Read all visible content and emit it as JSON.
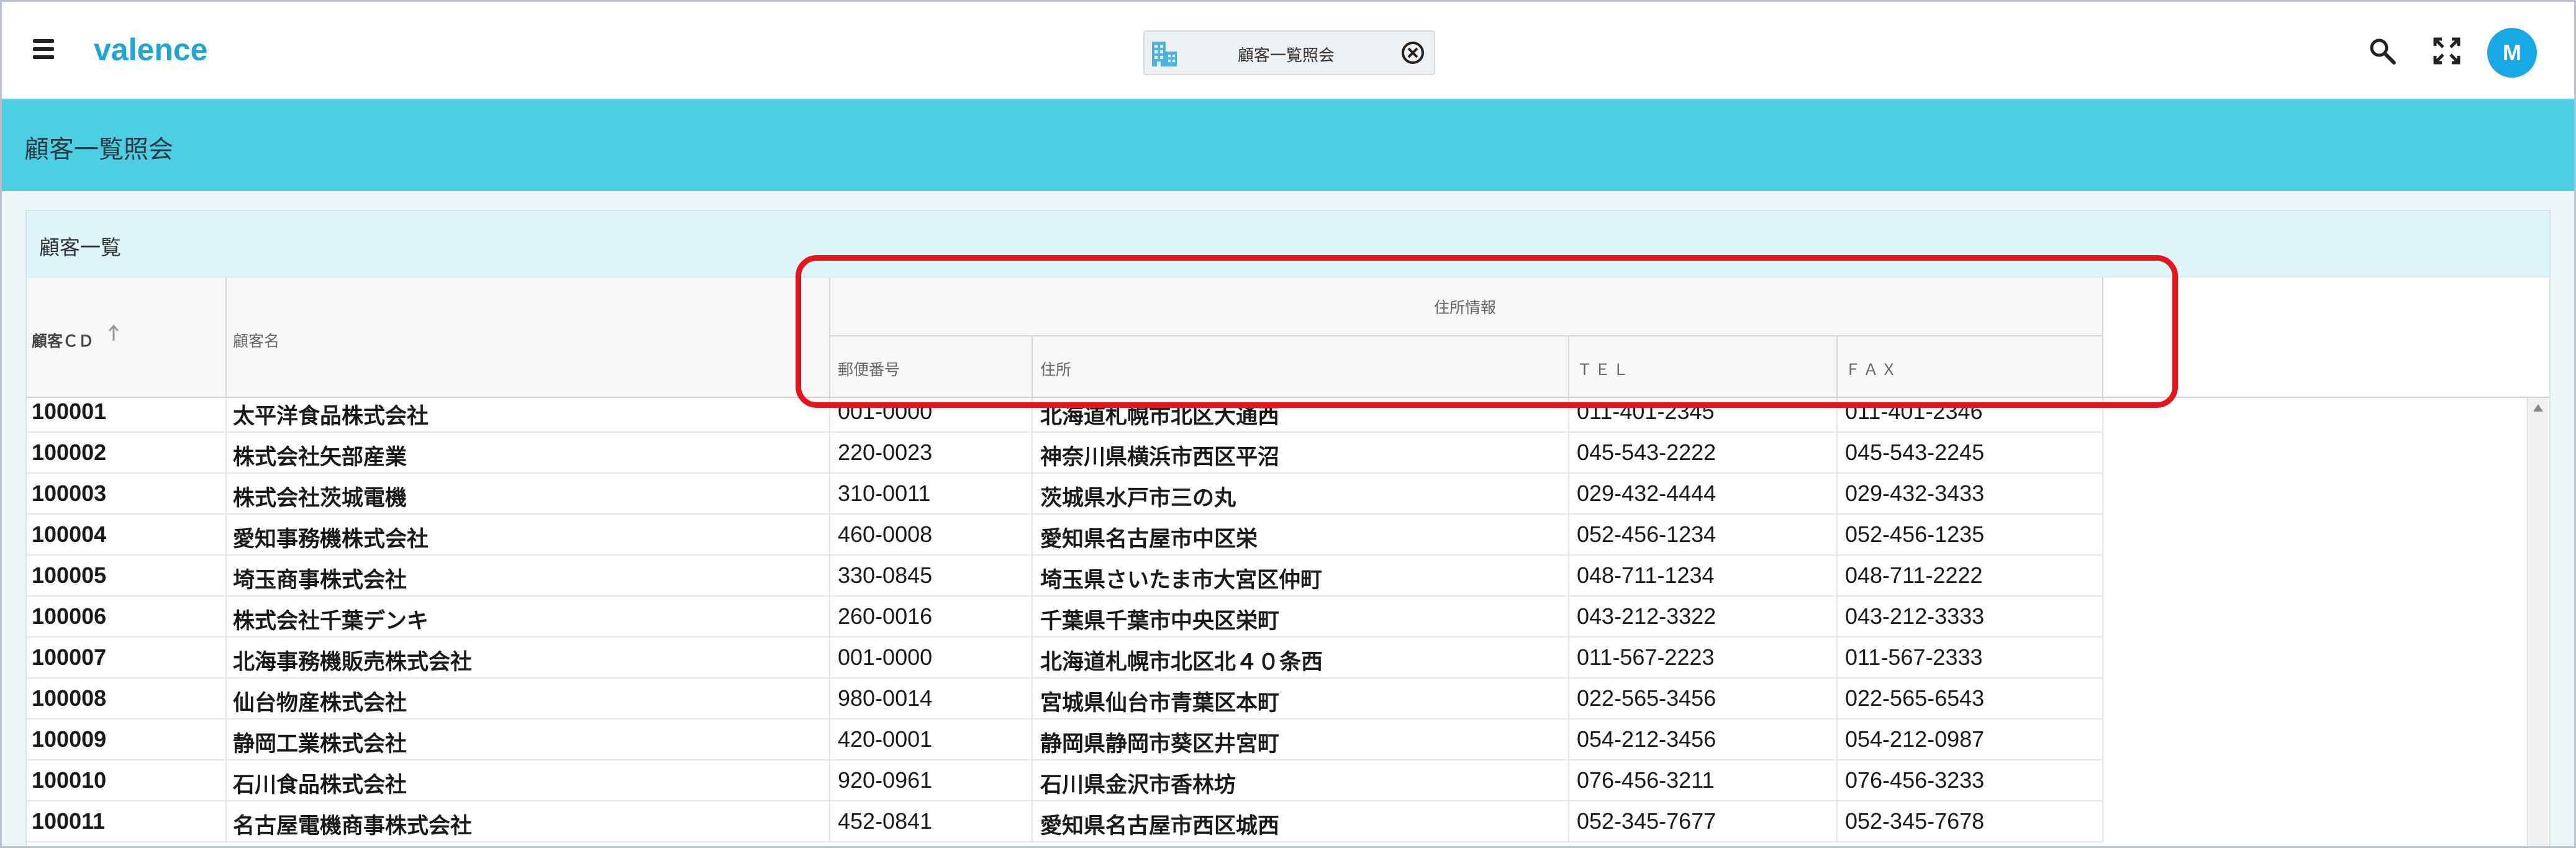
{
  "app": {
    "logo": "valence",
    "avatar_initial": "M"
  },
  "tab": {
    "label": "顧客一覧照会"
  },
  "page": {
    "title": "顧客一覧照会"
  },
  "panel": {
    "title": "顧客一覧"
  },
  "table": {
    "headers": {
      "code": "顧客ＣＤ",
      "name": "顧客名",
      "group": "住所情報",
      "zip": "郵便番号",
      "address": "住所",
      "tel": "ＴＥＬ",
      "fax": "ＦＡＸ"
    },
    "rows": [
      {
        "code": "100001",
        "name": "太平洋食品株式会社",
        "zip": "001-0000",
        "address": "北海道札幌市北区大通西",
        "tel": "011-401-2345",
        "fax": "011-401-2346"
      },
      {
        "code": "100002",
        "name": "株式会社矢部産業",
        "zip": "220-0023",
        "address": "神奈川県横浜市西区平沼",
        "tel": "045-543-2222",
        "fax": "045-543-2245"
      },
      {
        "code": "100003",
        "name": "株式会社茨城電機",
        "zip": "310-0011",
        "address": "茨城県水戸市三の丸",
        "tel": "029-432-4444",
        "fax": "029-432-3433"
      },
      {
        "code": "100004",
        "name": "愛知事務機株式会社",
        "zip": "460-0008",
        "address": "愛知県名古屋市中区栄",
        "tel": "052-456-1234",
        "fax": "052-456-1235"
      },
      {
        "code": "100005",
        "name": "埼玉商事株式会社",
        "zip": "330-0845",
        "address": "埼玉県さいたま市大宮区仲町",
        "tel": "048-711-1234",
        "fax": "048-711-2222"
      },
      {
        "code": "100006",
        "name": "株式会社千葉デンキ",
        "zip": "260-0016",
        "address": "千葉県千葉市中央区栄町",
        "tel": "043-212-3322",
        "fax": "043-212-3333"
      },
      {
        "code": "100007",
        "name": "北海事務機販売株式会社",
        "zip": "001-0000",
        "address": "北海道札幌市北区北４０条西",
        "tel": "011-567-2223",
        "fax": "011-567-2333"
      },
      {
        "code": "100008",
        "name": "仙台物産株式会社",
        "zip": "980-0014",
        "address": "宮城県仙台市青葉区本町",
        "tel": "022-565-3456",
        "fax": "022-565-6543"
      },
      {
        "code": "100009",
        "name": "静岡工業株式会社",
        "zip": "420-0001",
        "address": "静岡県静岡市葵区井宮町",
        "tel": "054-212-3456",
        "fax": "054-212-0987"
      },
      {
        "code": "100010",
        "name": "石川食品株式会社",
        "zip": "920-0961",
        "address": "石川県金沢市香林坊",
        "tel": "076-456-3211",
        "fax": "076-456-3233"
      },
      {
        "code": "100011",
        "name": "名古屋電機商事株式会社",
        "zip": "452-0841",
        "address": "愛知県名古屋市西区城西",
        "tel": "052-345-7677",
        "fax": "052-345-7678"
      }
    ]
  },
  "colors": {
    "accent": "#4ccfe3",
    "logo": "#1fa5d2",
    "avatar": "#17a9e6",
    "highlight": "#e8141c"
  },
  "icons": {
    "menu": "hamburger-icon",
    "tab": "building-icon",
    "close": "close-circle-icon",
    "search": "search-icon",
    "fullscreen": "fullscreen-icon",
    "sort": "sort-ascending-icon"
  }
}
